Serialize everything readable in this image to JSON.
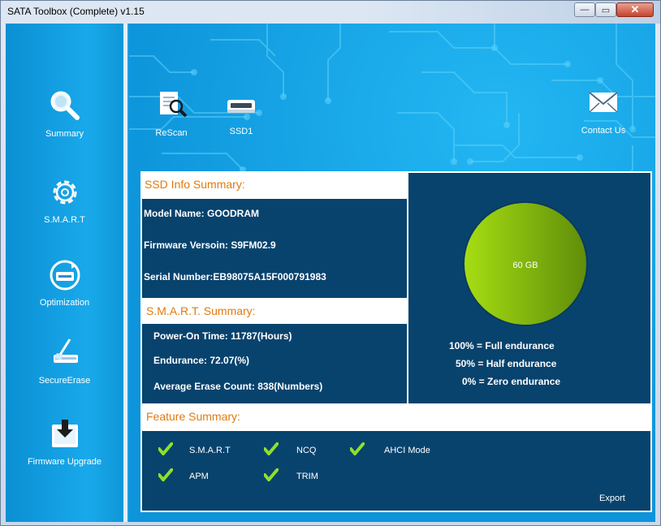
{
  "window": {
    "title": "SATA Toolbox (Complete) v1.15",
    "controls": {
      "minimize": "—",
      "maximize": "▭",
      "close": "✕"
    }
  },
  "sidebar": {
    "items": [
      {
        "label": "Summary",
        "icon": "magnifier-icon"
      },
      {
        "label": "S.M.A.R.T",
        "icon": "gear-icon"
      },
      {
        "label": "Optimization",
        "icon": "drive-optimize-icon"
      },
      {
        "label": "SecureErase",
        "icon": "eraser-icon"
      },
      {
        "label": "Firmware Upgrade",
        "icon": "download-icon"
      }
    ]
  },
  "toolbar": {
    "rescan_label": "ReScan",
    "drive_label": "SSD1",
    "contact_label": "Contact Us"
  },
  "ssd_info": {
    "header": "SSD Info Summary:",
    "model": "Model Name: GOODRAM",
    "firmware": "Firmware Versoin: S9FM02.9",
    "serial": "Serial Number:EB98075A15F000791983"
  },
  "smart_summary": {
    "header": "S.M.A.R.T. Summary:",
    "power_on": "Power-On Time: 11787(Hours)",
    "endurance": "Endurance: 72.07(%)",
    "erase_count": "Average Erase Count: 838(Numbers)"
  },
  "capacity": {
    "label": "60 GB",
    "legend": [
      "100% = Full endurance",
      "50% = Half endurance",
      "0% = Zero endurance"
    ],
    "colors": {
      "light": "#a6de12",
      "dark": "#5f8d0a"
    }
  },
  "features": {
    "header": "Feature Summary:",
    "items": [
      "S.M.A.R.T",
      "NCQ",
      "AHCI Mode",
      "APM",
      "TRIM"
    ],
    "check_color": "#8fe02a"
  },
  "export_label": "Export",
  "colors": {
    "panel": "#08436e",
    "header_text": "#e07a10",
    "background": "#1d9fe0"
  }
}
